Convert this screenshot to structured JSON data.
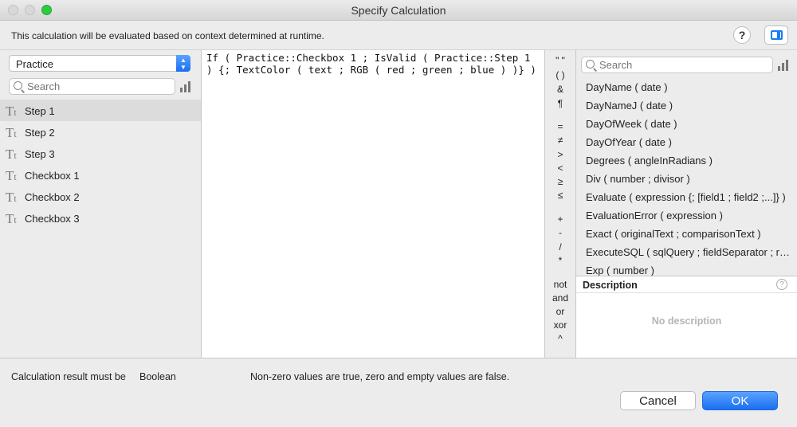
{
  "window": {
    "title": "Specify Calculation"
  },
  "info": {
    "text": "This calculation will be evaluated based on context determined at runtime.",
    "help_label": "?"
  },
  "left": {
    "table_select": "Practice",
    "search_placeholder": "Search",
    "fields": [
      {
        "label": "Step 1",
        "type_icon": "text-type-icon",
        "selected": true
      },
      {
        "label": "Step 2",
        "type_icon": "text-type-icon",
        "selected": false
      },
      {
        "label": "Step 3",
        "type_icon": "text-type-icon",
        "selected": false
      },
      {
        "label": "Checkbox 1",
        "type_icon": "text-type-icon",
        "selected": false
      },
      {
        "label": "Checkbox 2",
        "type_icon": "text-type-icon",
        "selected": false
      },
      {
        "label": "Checkbox 3",
        "type_icon": "text-type-icon",
        "selected": false
      }
    ]
  },
  "editor": {
    "formula": "If ( Practice::Checkbox 1 ; IsValid ( Practice::Step 1 ) {; TextColor ( text ; RGB ( red ; green ; blue ) )} )"
  },
  "operators": [
    "\" \"",
    "( )",
    "&",
    "¶",
    "=",
    "≠",
    ">",
    "<",
    "≥",
    "≤",
    "+",
    "-",
    "/",
    "*",
    "not",
    "and",
    "or",
    "xor",
    "^"
  ],
  "right": {
    "search_placeholder": "Search",
    "functions": [
      "DayName ( date )",
      "DayNameJ ( date )",
      "DayOfWeek ( date )",
      "DayOfYear ( date )",
      "Degrees ( angleInRadians )",
      "Div ( number ; divisor )",
      "Evaluate ( expression {; [field1 ; field2 ;...]} )",
      "EvaluationError ( expression )",
      "Exact ( originalText ; comparisonText )",
      "ExecuteSQL ( sqlQuery ; fieldSeparator ; r…",
      "Exp ( number )"
    ],
    "description_label": "Description",
    "description_text": "No description"
  },
  "bottom": {
    "result_label": "Calculation result must be",
    "result_type": "Boolean",
    "result_note": "Non-zero values are true, zero and empty values are false.",
    "cancel_label": "Cancel",
    "ok_label": "OK"
  },
  "colors": {
    "accent": "#1a6ff0",
    "zoom_button": "#2ecb41"
  }
}
